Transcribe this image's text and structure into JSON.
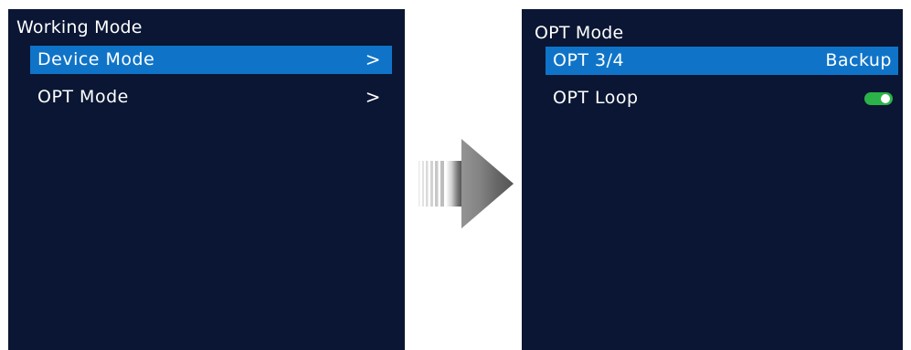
{
  "left_screen": {
    "title": "Working Mode",
    "items": [
      {
        "label": "Device Mode",
        "arrow": ">",
        "selected": true
      },
      {
        "label": "OPT Mode",
        "arrow": ">",
        "selected": false
      }
    ]
  },
  "right_screen": {
    "title": "OPT Mode",
    "items": [
      {
        "label": "OPT 3/4",
        "value": "Backup",
        "selected": true
      },
      {
        "label": "OPT Loop",
        "toggle_on": true,
        "selected": false
      }
    ]
  },
  "colors": {
    "screen_background": "#0a1633",
    "selection": "#0f74c8",
    "toggle_on": "#2bb34a",
    "arrow_fill": "#5a5a5a"
  }
}
